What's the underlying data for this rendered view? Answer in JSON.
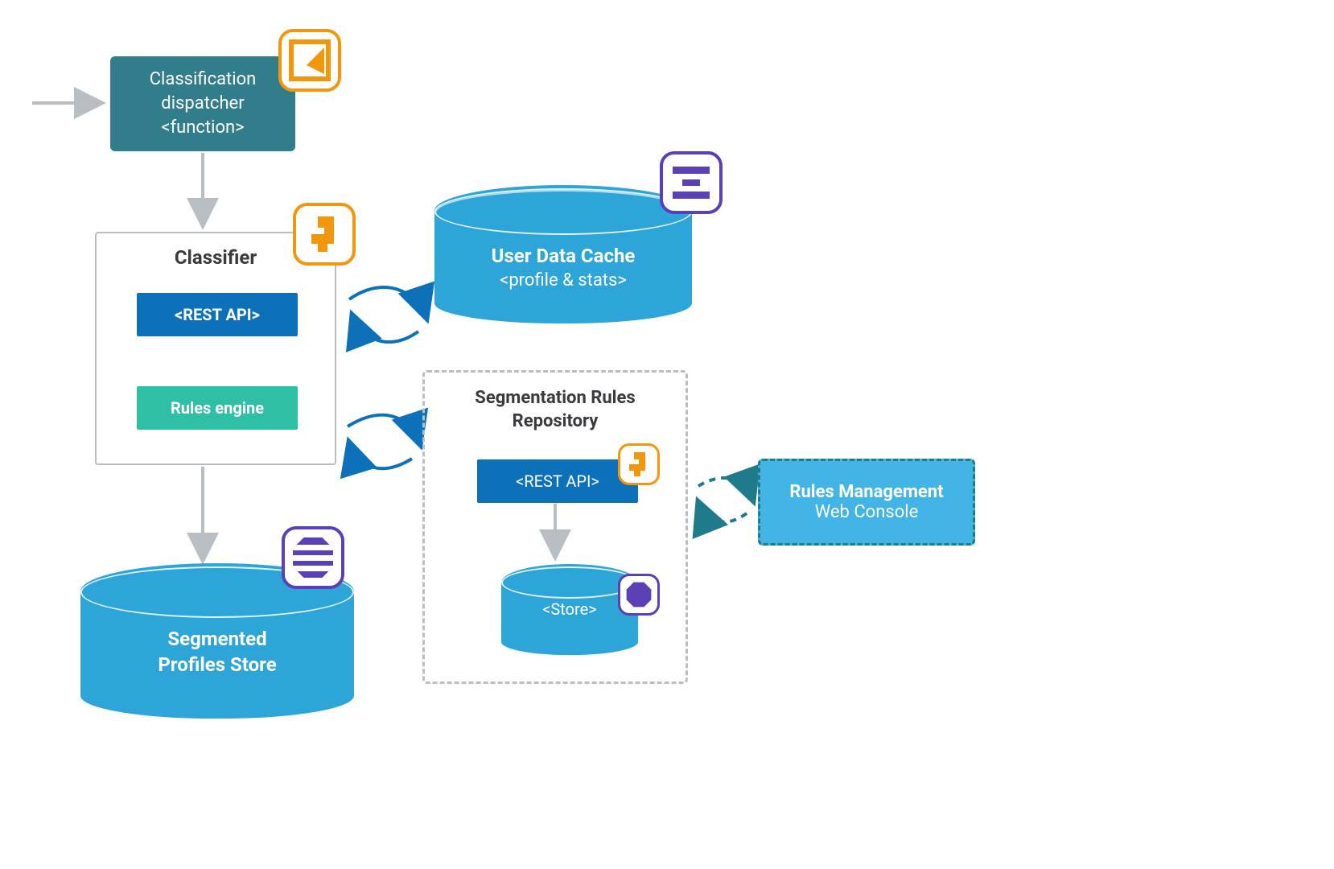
{
  "dispatcher": {
    "line1": "Classification",
    "line2": "dispatcher",
    "line3": "<function>",
    "icon": "triangle-in-square-icon"
  },
  "classifier": {
    "title": "Classifier",
    "rest_api": "<REST API>",
    "rules_engine": "Rules engine",
    "icon": "step-shape-icon"
  },
  "user_data_cache": {
    "title": "User Data Cache",
    "subtitle": "<profile & stats>",
    "icon": "bars-icon"
  },
  "segmented_profiles_store": {
    "line1": "Segmented",
    "line2": "Profiles Store",
    "icon": "striped-octagon-icon"
  },
  "segmentation_repo": {
    "title_line1": "Segmentation Rules",
    "title_line2": "Repository",
    "rest_api": "<REST API>",
    "rest_api_icon": "step-shape-icon",
    "store": "<Store>",
    "store_icon": "solid-circle-icon"
  },
  "rules_management": {
    "title": "Rules Management",
    "subtitle": "Web Console"
  },
  "colors": {
    "teal": "#317D8C",
    "blue": "#0C71B8",
    "cyan": "#2DA5D9",
    "green": "#2EBFA5",
    "orange": "#F2960C",
    "purple": "#5A3FB5",
    "grey": "#B9BEC3"
  },
  "connections": [
    {
      "from": "external-left",
      "to": "dispatcher",
      "style": "grey-arrow"
    },
    {
      "from": "dispatcher",
      "to": "classifier",
      "style": "grey-arrow"
    },
    {
      "from": "classifier.rest_api",
      "to": "classifier.rules_engine",
      "style": "grey-arrow"
    },
    {
      "from": "classifier",
      "to": "segmented_profiles_store",
      "style": "grey-arrow"
    },
    {
      "from": "classifier",
      "to": "user_data_cache",
      "style": "blue-loop-bidirectional"
    },
    {
      "from": "classifier",
      "to": "segmentation_repo",
      "style": "blue-loop-bidirectional"
    },
    {
      "from": "segmentation_repo.rest_api",
      "to": "segmentation_repo.store",
      "style": "grey-arrow"
    },
    {
      "from": "segmentation_repo",
      "to": "rules_management",
      "style": "teal-dashed-loop-bidirectional"
    }
  ]
}
